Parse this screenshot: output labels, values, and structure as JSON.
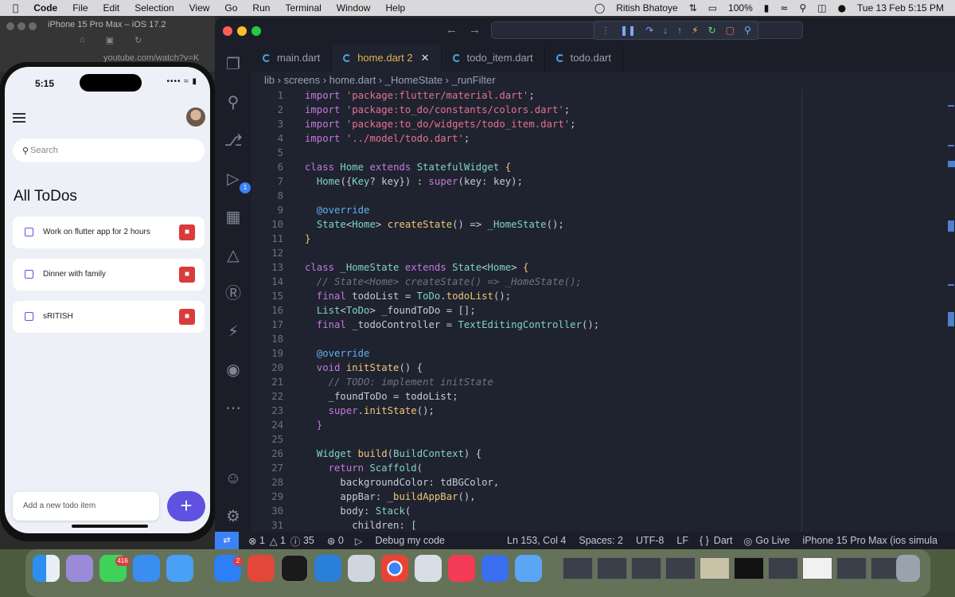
{
  "menubar": {
    "app": "Code",
    "items": [
      "File",
      "Edit",
      "Selection",
      "View",
      "Go",
      "Run",
      "Terminal",
      "Window",
      "Help"
    ],
    "user": "Ritish Bhatoye",
    "battery": "100%",
    "datetime": "Tue 13 Feb  5:15 PM"
  },
  "simulator": {
    "title": "iPhone 15 Pro Max – iOS 17.2",
    "url": "youtube.com/watch?v=K"
  },
  "phone": {
    "time": "5:15",
    "search_placeholder": "Search",
    "heading": "All ToDos",
    "todos": [
      {
        "text": "Work on flutter app for 2 hours"
      },
      {
        "text": "Dinner with family"
      },
      {
        "text": "sRITISH"
      }
    ],
    "add_placeholder": "Add a new todo item",
    "add_symbol": "+"
  },
  "editor": {
    "tabs": [
      {
        "label": "main.dart",
        "active": false,
        "suffix": ""
      },
      {
        "label": "home.dart",
        "active": true,
        "suffix": "2"
      },
      {
        "label": "todo_item.dart",
        "active": false,
        "suffix": ""
      },
      {
        "label": "todo.dart",
        "active": false,
        "suffix": ""
      }
    ],
    "breadcrumb": [
      "lib",
      "screens",
      "home.dart",
      "_HomeState",
      "_runFilter"
    ],
    "debug_badge": "1",
    "lines": [
      {
        "n": "1",
        "segs": [
          [
            "kw",
            "import "
          ],
          [
            "str",
            "'package:flutter/material.dart'"
          ],
          [
            "pl",
            ";"
          ]
        ]
      },
      {
        "n": "2",
        "segs": [
          [
            "kw",
            "import "
          ],
          [
            "str",
            "'package:to_do/constants/colors.dart'"
          ],
          [
            "pl",
            ";"
          ]
        ]
      },
      {
        "n": "3",
        "segs": [
          [
            "kw",
            "import "
          ],
          [
            "str",
            "'package:to_do/widgets/todo_item.dart'"
          ],
          [
            "pl",
            ";"
          ]
        ]
      },
      {
        "n": "4",
        "segs": [
          [
            "kw",
            "import "
          ],
          [
            "str",
            "'../model/todo.dart'"
          ],
          [
            "pl",
            ";"
          ]
        ]
      },
      {
        "n": "5",
        "segs": []
      },
      {
        "n": "6",
        "segs": [
          [
            "kw",
            "class "
          ],
          [
            "cls",
            "Home "
          ],
          [
            "kw",
            "extends "
          ],
          [
            "cls",
            "StatefulWidget "
          ],
          [
            "fn",
            "{"
          ]
        ]
      },
      {
        "n": "7",
        "segs": [
          [
            "pl",
            "  "
          ],
          [
            "cls",
            "Home"
          ],
          [
            "pl",
            "({"
          ],
          [
            "cls",
            "Key"
          ],
          [
            "pl",
            "? key}) : "
          ],
          [
            "kw",
            "super"
          ],
          [
            "pl",
            "(key: key);"
          ]
        ]
      },
      {
        "n": "8",
        "segs": []
      },
      {
        "n": "9",
        "segs": [
          [
            "ann",
            "  @override"
          ]
        ]
      },
      {
        "n": "10",
        "segs": [
          [
            "pl",
            "  "
          ],
          [
            "cls",
            "State"
          ],
          [
            "pl",
            "<"
          ],
          [
            "cls",
            "Home"
          ],
          [
            "pl",
            "> "
          ],
          [
            "fn",
            "createState"
          ],
          [
            "pl",
            "() => "
          ],
          [
            "cls",
            "_HomeState"
          ],
          [
            "pl",
            "();"
          ]
        ]
      },
      {
        "n": "11",
        "segs": [
          [
            "fn",
            "}"
          ]
        ]
      },
      {
        "n": "12",
        "segs": []
      },
      {
        "n": "13",
        "segs": [
          [
            "kw",
            "class "
          ],
          [
            "cls",
            "_HomeState "
          ],
          [
            "kw",
            "extends "
          ],
          [
            "cls",
            "State"
          ],
          [
            "pl",
            "<"
          ],
          [
            "cls",
            "Home"
          ],
          [
            "pl",
            "> "
          ],
          [
            "fn",
            "{"
          ]
        ]
      },
      {
        "n": "14",
        "segs": [
          [
            "cm",
            "  // State<Home> createState() => _HomeState();"
          ]
        ]
      },
      {
        "n": "15",
        "segs": [
          [
            "kw",
            "  final "
          ],
          [
            "pl",
            "todoList = "
          ],
          [
            "cls",
            "ToDo"
          ],
          [
            "pl",
            "."
          ],
          [
            "fn",
            "todoList"
          ],
          [
            "pl",
            "();"
          ]
        ]
      },
      {
        "n": "16",
        "segs": [
          [
            "pl",
            "  "
          ],
          [
            "cls",
            "List"
          ],
          [
            "pl",
            "<"
          ],
          [
            "cls",
            "ToDo"
          ],
          [
            "pl",
            "> _foundToDo = [];"
          ]
        ]
      },
      {
        "n": "17",
        "segs": [
          [
            "kw",
            "  final "
          ],
          [
            "pl",
            "_todoController = "
          ],
          [
            "cls",
            "TextEditingController"
          ],
          [
            "pl",
            "();"
          ]
        ]
      },
      {
        "n": "18",
        "segs": []
      },
      {
        "n": "19",
        "segs": [
          [
            "ann",
            "  @override"
          ]
        ]
      },
      {
        "n": "20",
        "segs": [
          [
            "kw",
            "  void "
          ],
          [
            "fn",
            "initState"
          ],
          [
            "pl",
            "() {"
          ]
        ]
      },
      {
        "n": "21",
        "segs": [
          [
            "cm",
            "    // TODO: implement initState"
          ]
        ]
      },
      {
        "n": "22",
        "segs": [
          [
            "pl",
            "    _foundToDo = todoList;"
          ]
        ]
      },
      {
        "n": "23",
        "segs": [
          [
            "kw",
            "    super"
          ],
          [
            "pl",
            "."
          ],
          [
            "fn",
            "initState"
          ],
          [
            "pl",
            "();"
          ]
        ]
      },
      {
        "n": "24",
        "segs": [
          [
            "kw",
            "  }"
          ]
        ]
      },
      {
        "n": "25",
        "segs": []
      },
      {
        "n": "26",
        "segs": [
          [
            "pl",
            "  "
          ],
          [
            "cls",
            "Widget "
          ],
          [
            "fn",
            "build"
          ],
          [
            "pl",
            "("
          ],
          [
            "cls",
            "BuildContext"
          ],
          [
            "pl",
            ") {"
          ]
        ]
      },
      {
        "n": "27",
        "segs": [
          [
            "kw",
            "    return "
          ],
          [
            "cls",
            "Scaffold"
          ],
          [
            "pl",
            "("
          ]
        ]
      },
      {
        "n": "28",
        "segs": [
          [
            "pl",
            "      backgroundColor: tdBGColor,"
          ]
        ]
      },
      {
        "n": "29",
        "segs": [
          [
            "pl",
            "      appBar: "
          ],
          [
            "fn",
            "_buildAppBar"
          ],
          [
            "pl",
            "(),"
          ]
        ]
      },
      {
        "n": "30",
        "segs": [
          [
            "pl",
            "      body: "
          ],
          [
            "cls",
            "Stack"
          ],
          [
            "pl",
            "("
          ]
        ]
      },
      {
        "n": "31",
        "segs": [
          [
            "pl",
            "        children: ["
          ]
        ]
      }
    ]
  },
  "status": {
    "errors": "1",
    "warnings": "1",
    "info": "35",
    "ports": "0",
    "debug": "Debug my code",
    "position": "Ln 153, Col 4",
    "spaces": "Spaces: 2",
    "encoding": "UTF-8",
    "eol": "LF",
    "language": "Dart",
    "live": "Go Live",
    "device": "iPhone 15 Pro Max (ios simula"
  },
  "dock": {
    "messages_badge": "416",
    "appstore_badge": "2"
  },
  "colors": {
    "accent": "#5f52e0",
    "delete": "#d93b3b",
    "editor_bg": "#1f2330"
  }
}
